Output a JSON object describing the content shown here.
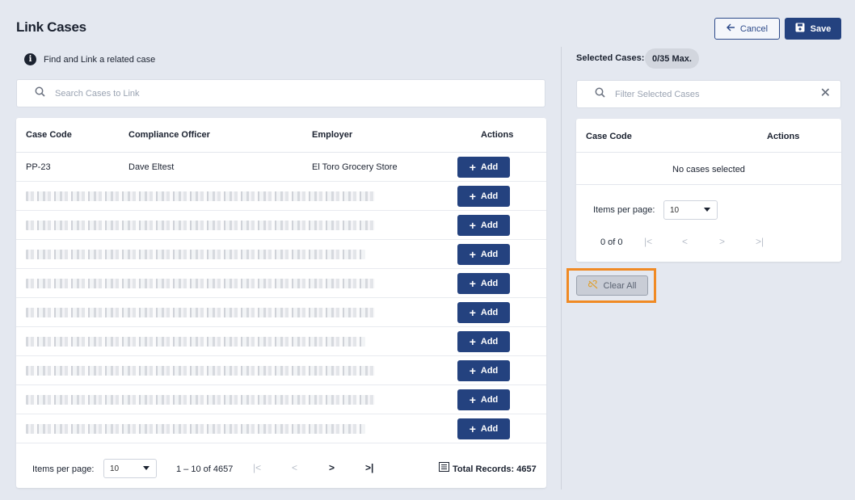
{
  "header": {
    "title": "Link Cases",
    "cancel_label": "Cancel",
    "save_label": "Save"
  },
  "info": {
    "text": "Find and Link a related case"
  },
  "search": {
    "placeholder": "Search Cases to Link"
  },
  "table": {
    "columns": [
      "Case Code",
      "Compliance Officer",
      "Employer",
      "Actions"
    ],
    "first_row": {
      "case_code": "PP-23",
      "officer": "Dave Eltest",
      "employer": "El Toro Grocery Store"
    },
    "add_label": "Add",
    "redacted_rows": 9
  },
  "pager": {
    "items_per_page_label": "Items per page:",
    "items_per_page": "10",
    "range": "1 – 10 of 4657",
    "total_records": "Total Records: 4657"
  },
  "selected": {
    "label": "Selected Cases:",
    "badge": "0/35 Max.",
    "filter_placeholder": "Filter Selected Cases",
    "columns": [
      "Case Code",
      "Actions"
    ],
    "empty_text": "No cases selected",
    "items_per_page_label": "Items per page:",
    "items_per_page": "10",
    "range": "0 of 0",
    "clear_all_label": "Clear All"
  },
  "colors": {
    "primary": "#24427f",
    "highlight": "#f08a24",
    "background": "#e4e8f0"
  }
}
